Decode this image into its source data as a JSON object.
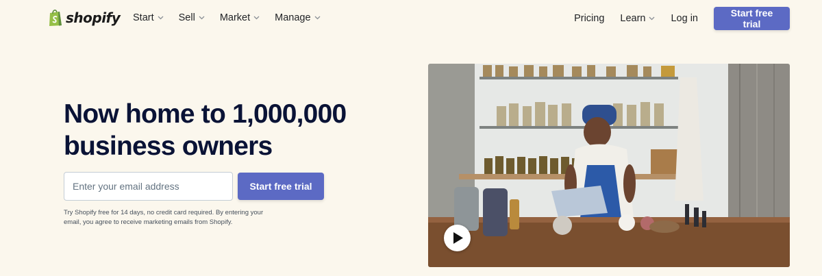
{
  "brand": {
    "name": "shopify",
    "color": "#95bf47"
  },
  "nav": {
    "left": [
      {
        "label": "Start",
        "icon": "chevron-down-icon"
      },
      {
        "label": "Sell",
        "icon": "chevron-down-icon"
      },
      {
        "label": "Market",
        "icon": "chevron-down-icon"
      },
      {
        "label": "Manage",
        "icon": "chevron-down-icon"
      }
    ],
    "right": {
      "pricing": "Pricing",
      "learn": "Learn",
      "login": "Log in",
      "cta": "Start free trial"
    }
  },
  "hero": {
    "title": "Now home to 1,000,000 business owners",
    "email_placeholder": "Enter your email address",
    "cta": "Start free trial",
    "disclaimer": "Try Shopify free for 14 days, no credit card required. By entering your email, you agree to receive marketing emails from Shopify."
  },
  "media": {
    "video_control": "play-icon"
  },
  "colors": {
    "accent": "#5c6ac4",
    "background": "#fbf7ed",
    "heading": "#0a1336"
  }
}
